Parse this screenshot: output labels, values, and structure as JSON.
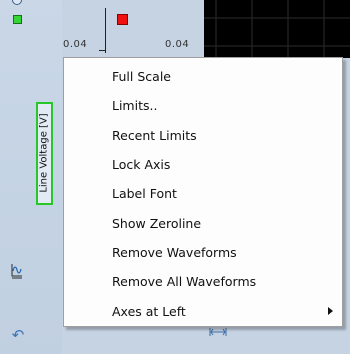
{
  "plot": {
    "left_tick": "0.04",
    "right_tick": "0.04",
    "axis_label": "Line Voltage [V]",
    "green_marker_color": "#33d633",
    "red_marker_color": "#ef1010"
  },
  "context_menu": {
    "items": [
      {
        "label": "Full Scale",
        "has_submenu": false
      },
      {
        "label": "Limits..",
        "has_submenu": false
      },
      {
        "label": "Recent Limits",
        "has_submenu": false
      },
      {
        "label": "Lock Axis",
        "has_submenu": false
      },
      {
        "label": "Label Font",
        "has_submenu": false
      },
      {
        "label": "Show Zeroline",
        "has_submenu": false
      },
      {
        "label": "Remove Waveforms",
        "has_submenu": false
      },
      {
        "label": "Remove All Waveforms",
        "has_submenu": false
      },
      {
        "label": "Axes at Left",
        "has_submenu": true
      }
    ]
  },
  "icons": {
    "waveform_toggle": "waveform-icon",
    "undo": "undo-icon",
    "zoom_fit": "zoom-fit-icon"
  }
}
